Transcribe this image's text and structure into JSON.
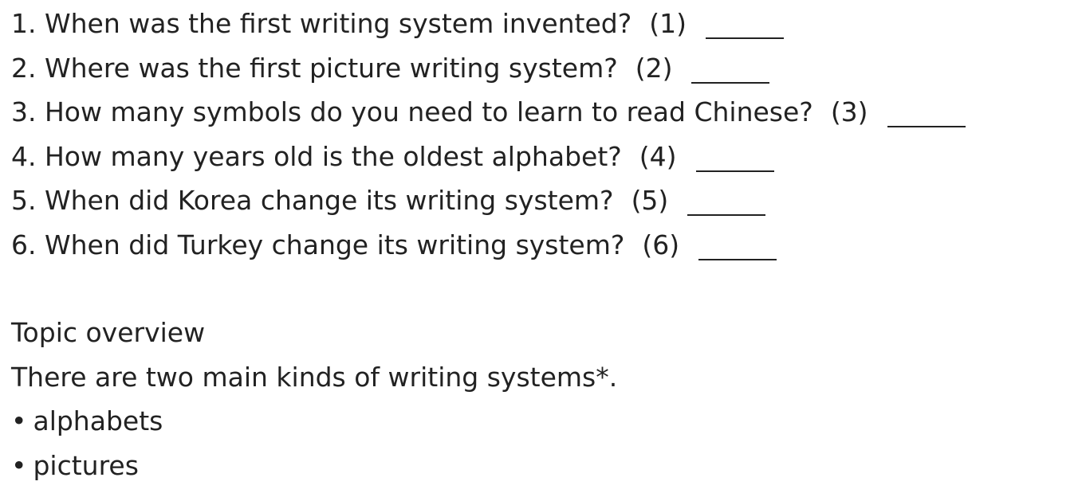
{
  "questions": [
    {
      "text": "1. When was the first writing system invented?",
      "num": "(1)"
    },
    {
      "text": "2. Where was the first picture writing system?",
      "num": "(2)"
    },
    {
      "text": "3. How many symbols do you need to learn to read Chinese?",
      "num": "(3)"
    },
    {
      "text": "4. How many years old is the oldest alphabet?",
      "num": "(4)"
    },
    {
      "text": "5. When did Korea change its writing system?",
      "num": "(5)"
    },
    {
      "text": "6. When did Turkey change its writing system?",
      "num": "(6)"
    }
  ],
  "overview": {
    "heading": "Topic overview",
    "intro": "There are two main kinds of writing systems*.",
    "bullet_char": "•",
    "items": [
      "alphabets",
      "pictures"
    ]
  }
}
